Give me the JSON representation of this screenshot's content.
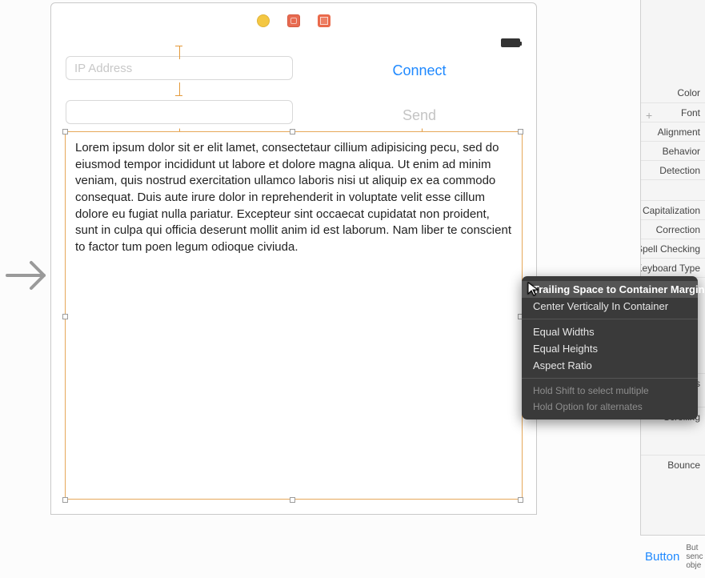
{
  "inputs": {
    "ip_placeholder": "IP Address",
    "msg_value": ""
  },
  "buttons": {
    "connect": "Connect",
    "send": "Send"
  },
  "textview_content": "Lorem ipsum dolor sit er elit lamet, consectetaur cillium adipisicing pecu, sed do eiusmod tempor incididunt ut labore et dolore magna aliqua. Ut enim ad minim veniam, quis nostrud exercitation ullamco laboris nisi ut aliquip ex ea commodo consequat. Duis aute irure dolor in reprehenderit in voluptate velit esse cillum dolore eu fugiat nulla pariatur. Excepteur sint occaecat cupidatat non proident, sunt in culpa qui officia deserunt mollit anim id est laborum. Nam liber te conscient to factor tum poen legum odioque civiuda.",
  "popover": {
    "items": [
      "Trailing Space to Container Margin",
      "Center Vertically In Container",
      "Equal Widths",
      "Equal Heights",
      "Aspect Ratio"
    ],
    "hints": [
      "Hold Shift to select multiple",
      "Hold Option for alternates"
    ]
  },
  "inspector": {
    "rows": [
      "Color",
      "Font",
      "Alignment",
      "Behavior",
      "Detection",
      "Capitalization",
      "Correction",
      "Spell Checking",
      "Keyboard Type",
      "Scroll Indicators",
      "Scrolling",
      "Bounce"
    ],
    "button_label": "Button",
    "button_desc_1": "But",
    "button_desc_2": "senc",
    "button_desc_3": "obje"
  }
}
